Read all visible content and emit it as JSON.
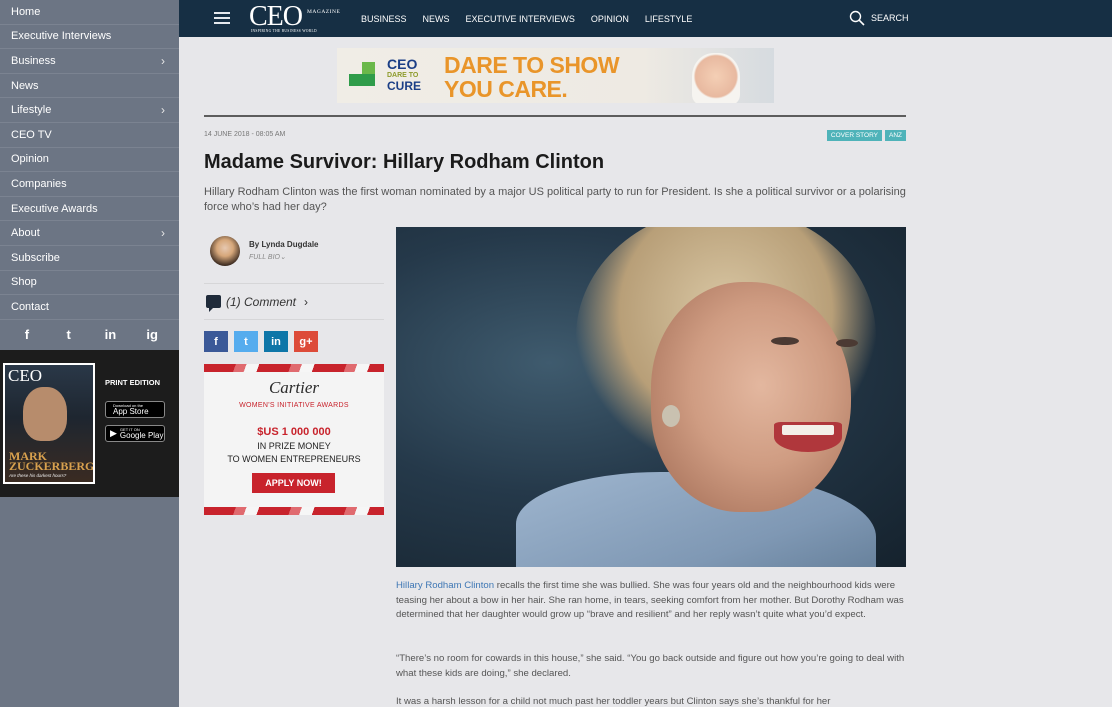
{
  "sidebar": {
    "items": [
      {
        "label": "Home",
        "has_chevron": false
      },
      {
        "label": "Executive Interviews",
        "has_chevron": false
      },
      {
        "label": "Business",
        "has_chevron": true
      },
      {
        "label": "News",
        "has_chevron": false
      },
      {
        "label": "Lifestyle",
        "has_chevron": true
      },
      {
        "label": "CEO TV",
        "has_chevron": false
      },
      {
        "label": "Opinion",
        "has_chevron": false
      },
      {
        "label": "Companies",
        "has_chevron": false
      },
      {
        "label": "Executive Awards",
        "has_chevron": false
      },
      {
        "label": "About",
        "has_chevron": true
      },
      {
        "label": "Subscribe",
        "has_chevron": false
      },
      {
        "label": "Shop",
        "has_chevron": false
      },
      {
        "label": "Contact",
        "has_chevron": false
      }
    ],
    "chevron_glyph": "›",
    "socials": [
      "f",
      "t",
      "in",
      "ig"
    ],
    "print": {
      "label": "PRINT EDITION",
      "cover_masthead": "CEO",
      "cover_name": "MARK ZUCKERBERG",
      "cover_sub": "Are these his darkest hours?",
      "app_store_small": "Download on the",
      "app_store_big": "App Store",
      "google_small": "GET IT ON",
      "google_big": "Google Play"
    }
  },
  "topbar": {
    "logo_text": "CEO",
    "logo_magazine": "MAGAZINE",
    "logo_tagline": "INSPIRING THE BUSINESS WORLD",
    "nav": [
      "BUSINESS",
      "NEWS",
      "EXECUTIVE INTERVIEWS",
      "OPINION",
      "LIFESTYLE"
    ],
    "search_label": "SEARCH"
  },
  "banner": {
    "brand": "CEO",
    "dare_to": "DARE TO",
    "cure": "CURE",
    "headline_1": "DARE TO SHOW",
    "headline_2": "YOU CARE."
  },
  "article": {
    "date": "14 JUNE 2018 - 08:05 AM",
    "tags": [
      "COVER STORY",
      "ANZ"
    ],
    "title": "Madame Survivor: Hillary Rodham Clinton",
    "standfirst": "Hillary Rodham Clinton was the first woman nominated by a major US political party to run for President. Is she a political survivor or a polarising force who’s had her day?",
    "byline": "By Lynda Dugdale",
    "full_bio": "FULL BIO",
    "comment": "(1) Comment",
    "share": [
      {
        "glyph": "f",
        "color": "#3b5998"
      },
      {
        "glyph": "t",
        "color": "#55acee"
      },
      {
        "glyph": "in",
        "color": "#0e76a8"
      },
      {
        "glyph": "g+",
        "color": "#dd4b39"
      }
    ],
    "link_text": "Hillary Rodham Clinton",
    "p1_rest": " recalls the first time she was bullied. She was four years old and the neighbourhood kids were teasing her about a bow in her hair. She ran home, in tears, seeking comfort from her mother. But Dorothy Rodham was determined that her daughter would grow up “brave and resilient” and her reply wasn’t quite what you’d expect.",
    "p2": "“There’s no room for cowards in this house,” she said. “You go back outside and figure out how you’re going to deal with what these kids are doing,” she declared.",
    "p3": "It was a harsh lesson for a child not much past her toddler years but Clinton says she’s thankful for her"
  },
  "cartier_ad": {
    "brand": "Cartier",
    "awards": "WOMEN'S INITIATIVE AWARDS",
    "money": "$US 1 000 000",
    "line2": "IN PRIZE MONEY",
    "line3": "TO WOMEN ENTREPRENEURS",
    "cta": "APPLY NOW!"
  },
  "colors": {
    "topbar": "#162f44",
    "sidebar": "#6c7584",
    "tag": "#4fb3b9",
    "link": "#3d76b4",
    "cartier_red": "#c8232c",
    "banner_orange": "#e9952a"
  }
}
